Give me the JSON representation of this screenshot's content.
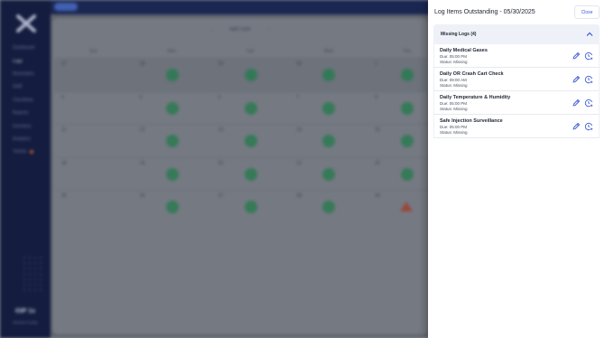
{
  "drawer": {
    "title": "Log Items Outstanding - 05/30/2025",
    "close_label": "Close",
    "section_title": "Missing Logs (4)",
    "logs": [
      {
        "name": "Daily Medical Gases",
        "due": "Due: 05:00 PM",
        "status": "Status: Missing"
      },
      {
        "name": "Daily OR Crash Cart Check",
        "due": "Due: 09:00 AM",
        "status": "Status: Missing"
      },
      {
        "name": "Daily Temperature & Humidity",
        "due": "Due: 05:00 PM",
        "status": "Status: Missing"
      },
      {
        "name": "Safe Injection Surveillance",
        "due": "Due: 05:00 PM",
        "status": "Status: Missing"
      }
    ]
  },
  "background": {
    "top_pill": "",
    "sidebar_items": [
      "Dashboard",
      "Logs",
      "Reminders",
      "Staff",
      "Checklists",
      "Reports",
      "Inventory",
      "Analytics",
      "Tickets"
    ],
    "sidebar_time": "03P 1s",
    "sidebar_sub": "Medical Facility",
    "calendar_month": "MAY 2025",
    "weekdays": [
      "Sun",
      "Mon",
      "Tue",
      "Wed",
      "Thu"
    ],
    "weeks": [
      [
        "27",
        "28",
        "29",
        "30",
        "1"
      ],
      [
        "4",
        "5",
        "6",
        "7",
        "8"
      ],
      [
        "11",
        "12",
        "13",
        "14",
        "15"
      ],
      [
        "18",
        "19",
        "20",
        "21",
        "22"
      ],
      [
        "25",
        "26",
        "27",
        "28",
        "29"
      ]
    ]
  },
  "colors": {
    "accent": "#3a5bd4",
    "ok": "#2f8f5a",
    "alert": "#b4533e",
    "sidebar": "#141d45"
  }
}
